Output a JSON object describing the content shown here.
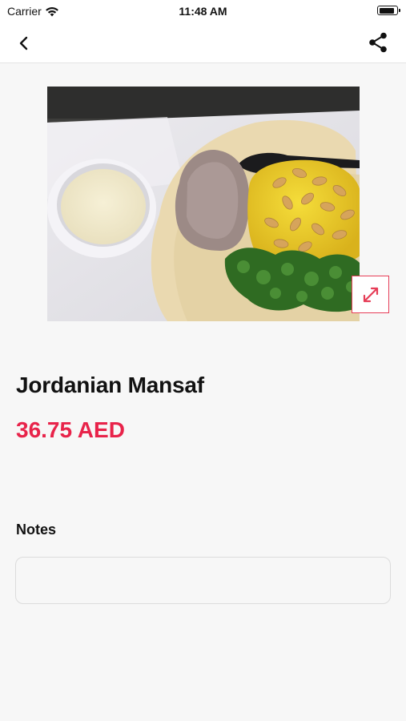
{
  "status_bar": {
    "carrier": "Carrier",
    "time": "11:48 AM",
    "battery_level": 0.9
  },
  "nav": {
    "back_icon": "chevron-left-icon",
    "share_icon": "share-icon"
  },
  "product": {
    "image_alt": "",
    "name": "Jordanian Mansaf",
    "price": "36.75 AED",
    "expand_icon": "expand-icon"
  },
  "notes": {
    "label": "Notes",
    "value": "",
    "placeholder": ""
  },
  "colors": {
    "accent": "#e8234a",
    "expand_border": "#e63d57",
    "background": "#f7f7f7"
  }
}
